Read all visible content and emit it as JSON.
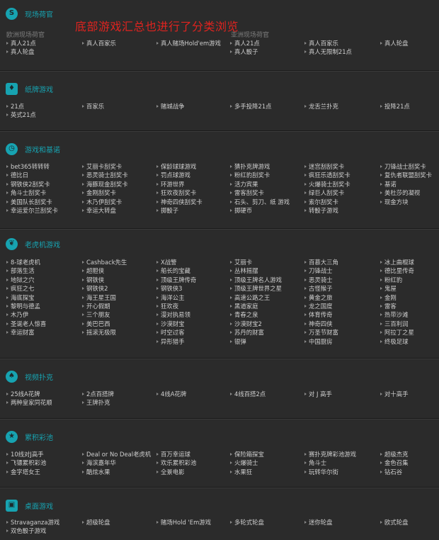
{
  "overlay_text": "底部游戏汇总也进行了分类浏览",
  "colors": {
    "accent": "#17a3b1",
    "overlay": "#e0231f",
    "background": "#2b2b2b"
  },
  "sections": [
    {
      "id": "live-casino",
      "title": "现场荷官",
      "icon": "s-icon",
      "sublabels": [
        "欧洲现场荷官",
        "亚洲现场荷官"
      ],
      "rows": [
        [
          "真人21点",
          "真人百家乐",
          "真人赌场Hold'em游戏",
          "真人21点",
          "真人百家乐",
          "真人轮盘"
        ],
        [
          "真人轮盘",
          "",
          "",
          "真人骰子",
          "真人无限制21点",
          ""
        ]
      ]
    },
    {
      "id": "card-games",
      "title": "纸牌游戏",
      "icon": "cards-icon",
      "sublabels": [],
      "rows": [
        [
          "21点",
          "百家乐",
          "赌城战争",
          "多手投降21点",
          "龙舌兰扑克",
          "投降21点"
        ],
        [
          "英式21点",
          "",
          "",
          "",
          "",
          ""
        ]
      ]
    },
    {
      "id": "arcade",
      "title": "游戏和基诺",
      "icon": "clock-icon",
      "sublabels": [],
      "rows": [
        [
          "bet365转转转",
          "艾丽卡刮奖卡",
          "保龄球球游戏",
          "猜扑克牌游戏",
          "迷宫刮刮奖卡",
          "刀锋战士刮奖卡"
        ],
        [
          "德比日",
          "恶灵骑士刮奖卡",
          "罚点球游戏",
          "粉红豹刮奖卡",
          "疯狂乐透刮奖卡",
          "复仇者联盟刮奖卡"
        ],
        [
          "钢铁侠2刮奖卡",
          "海豚现金刮奖卡",
          "环游世界",
          "活力宾果",
          "火爆骑士刮奖卡",
          "基诺"
        ],
        [
          "角斗士刮奖卡",
          "金刚刮奖卡",
          "狂欢夜刮奖卡",
          "雷客刮奖卡",
          "绿巨人刮奖卡",
          "美杜莎的凝视"
        ],
        [
          "美国队长刮奖卡",
          "木乃伊刮奖卡",
          "神奇四侠刮奖卡",
          "石头、剪刀、纸 游戏",
          "索尔刮奖卡",
          "现金方块"
        ],
        [
          "幸运爱尔兰刮奖卡",
          "幸运大转盘",
          "掷骰子",
          "掷硬币",
          "转骰子游戏",
          ""
        ]
      ]
    },
    {
      "id": "slots",
      "title": "老虎机游戏",
      "icon": "cherry-icon",
      "sublabels": [],
      "rows": [
        [
          "8-球老虎机",
          "Cashback先生",
          "X战警",
          "艾丽卡",
          "百慕大三角",
          "冰上曲棍球"
        ],
        [
          "部落生活",
          "超胆侠",
          "船长的宝藏",
          "丛林摇摆",
          "刀锋战士",
          "德比里传奇"
        ],
        [
          "地狱之穴",
          "钢铁侠",
          "顶级王牌传奇",
          "顶级王牌名人游戏",
          "恶灵骑士",
          "粉红豹"
        ],
        [
          "疯狂之七",
          "钢铁侠2",
          "钢铁侠3",
          "顶级王牌世界之星",
          "古怪猴子",
          "鬼屋"
        ],
        [
          "海底探宝",
          "海王星王国",
          "海洋公主",
          "高速公路之王",
          "黄金之旅",
          "金刚"
        ],
        [
          "黎明与德孟",
          "开心假期",
          "狂欢夜",
          "黑道家庭",
          "龙之国度",
          "雷客"
        ],
        [
          "木乃伊",
          "三个朋友",
          "漫对执易领",
          "青春之泉",
          "体育传奇",
          "热带沙滩"
        ],
        [
          "圣诞老人惊喜",
          "美巴巴西",
          "沙漠财宝",
          "沙漠财宝2",
          "神奇四侠",
          "三百利润"
        ],
        [
          "幸运财富",
          "摇滚无极限",
          "时空过客",
          "苏丹的财富",
          "万圣节财富",
          "阿拉丁之星"
        ],
        [
          "",
          "",
          "异形猎手",
          "银弹",
          "中国厨房",
          "终极足球"
        ]
      ]
    },
    {
      "id": "video-poker",
      "title": "视频扑克",
      "icon": "spade-icon",
      "sublabels": [],
      "rows": [
        [
          "25线A花牌",
          "2点百搭牌",
          "4线A花牌",
          "4线百搭2点",
          "对 J 高手",
          "对十高手"
        ],
        [
          "两种皇家同花顺",
          "王牌扑克",
          "",
          "",
          "",
          ""
        ]
      ]
    },
    {
      "id": "jackpots",
      "title": "累积彩池",
      "icon": "star-icon",
      "sublabels": [],
      "rows": [
        [
          "10线对J高手",
          "Deal or No Deal老虎机",
          "百万幸运球",
          "保险箱探宝",
          "赛扑克牌彩池游戏",
          "超级杰克"
        ],
        [
          "飞镖累积彩池",
          "海滨嘉年华",
          "欢乐累积彩池",
          "火爆骑士",
          "角斗士",
          "金色召集"
        ],
        [
          "金字塔女王",
          "酷炫水果",
          "全景电影",
          "水果狂",
          "玩转华尔街",
          "钻石谷"
        ]
      ]
    },
    {
      "id": "table-games",
      "title": "桌面游戏",
      "icon": "dice-icon",
      "sublabels": [],
      "rows": [
        [
          "Stravaganza游戏",
          "超级轮盘",
          "赌场Hold 'Em游戏",
          "多轮式轮盘",
          "迷你轮盘",
          "欧式轮盘"
        ],
        [
          "双色骰子游戏",
          "",
          "",
          "",
          "",
          ""
        ]
      ]
    }
  ]
}
